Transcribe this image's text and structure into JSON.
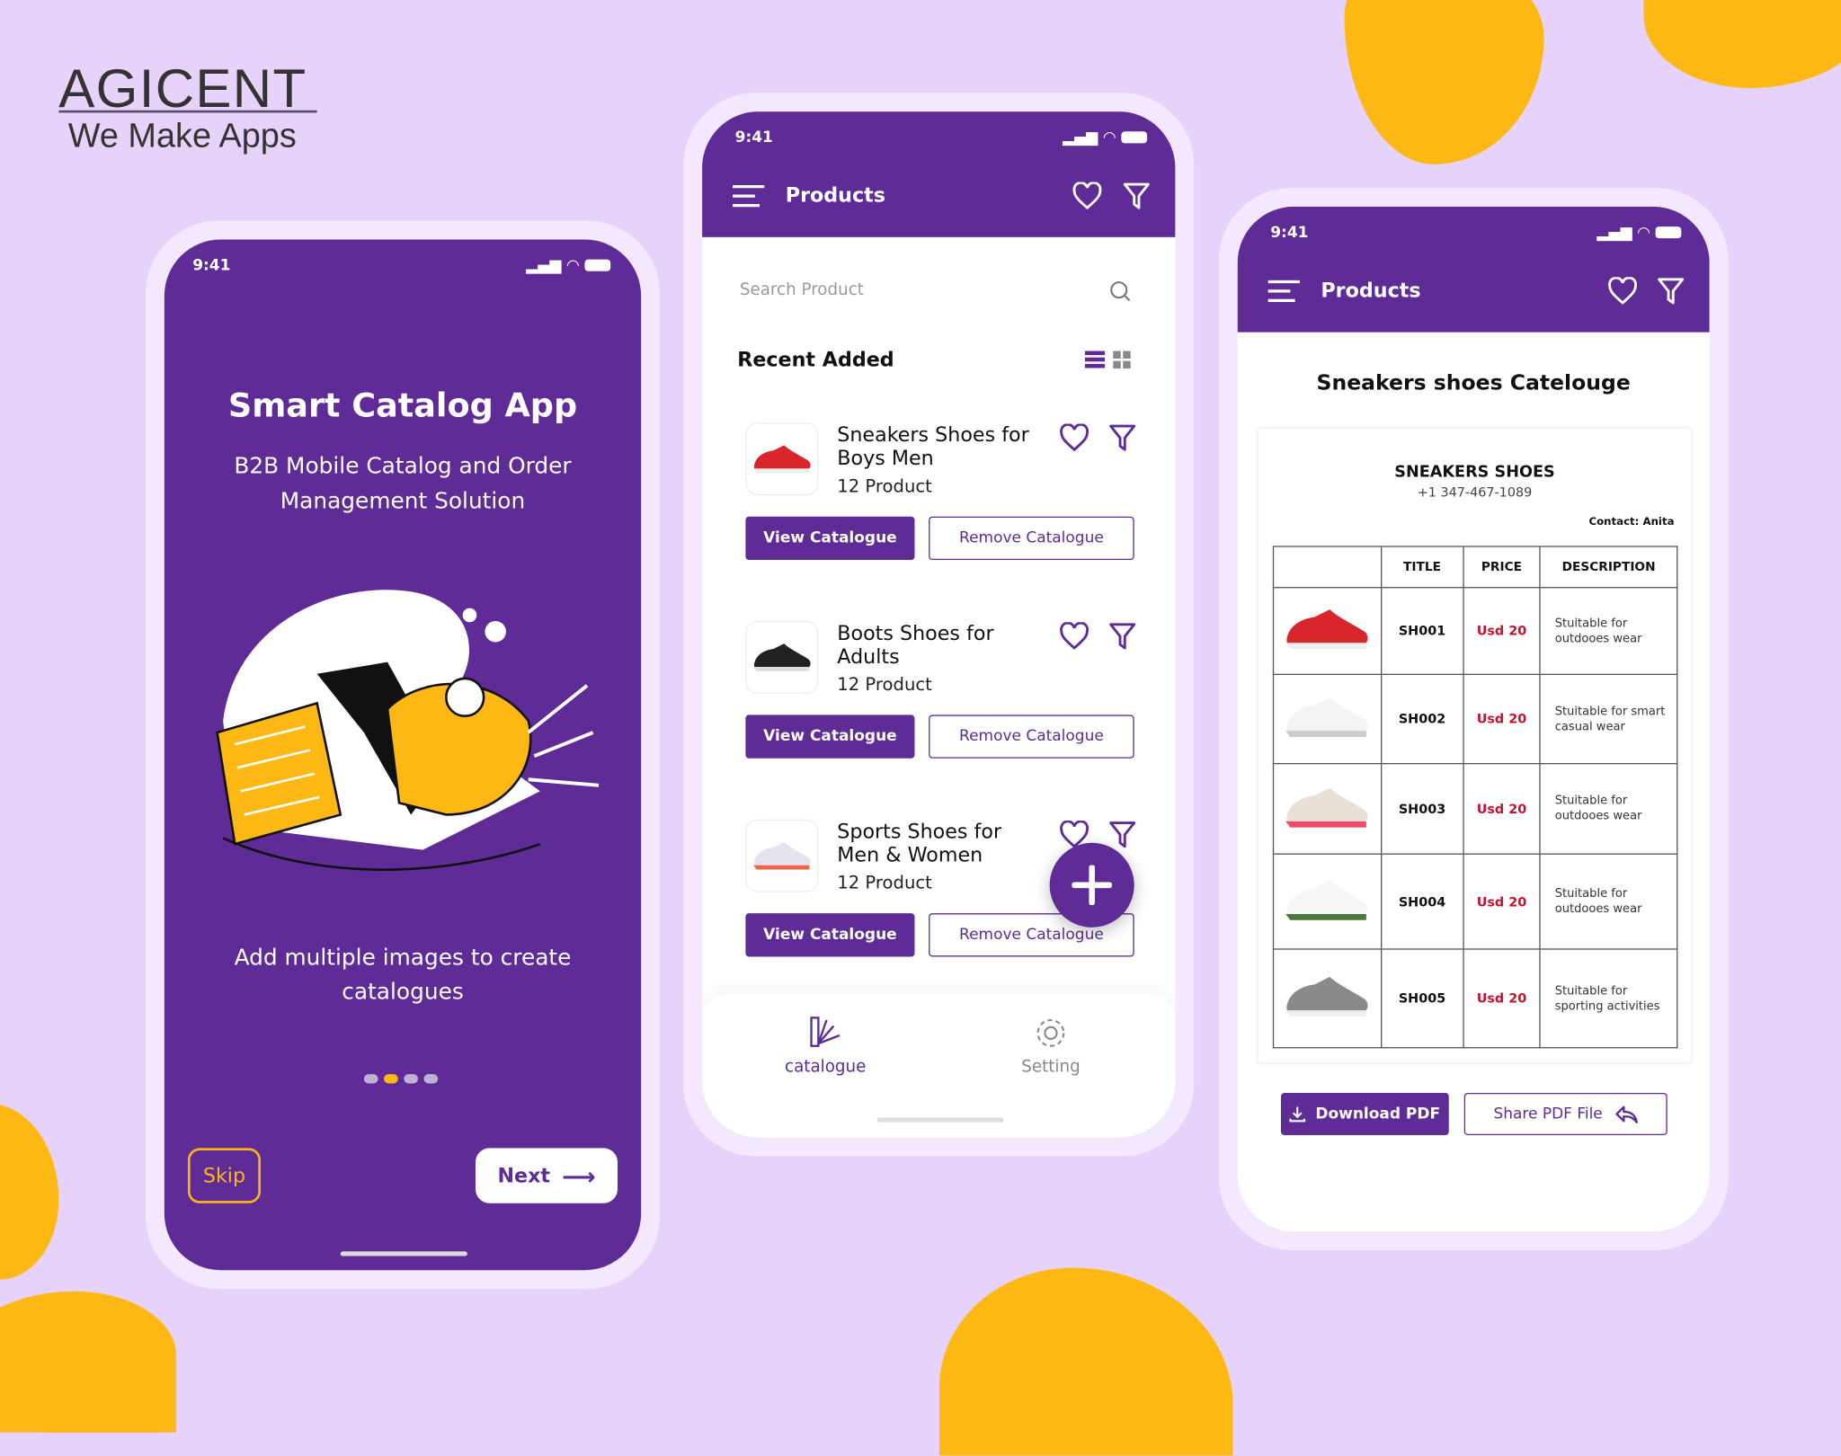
{
  "brand": {
    "logo": "AGICENT",
    "tagline": "We Make Apps"
  },
  "colors": {
    "primary": "#5e2b97",
    "background": "#e6d2fb",
    "accent": "#fdb813",
    "price": "#c8102e"
  },
  "status_time": "9:41",
  "onboarding": {
    "title": "Smart Catalog App",
    "subtitle": "B2B Mobile Catalog and Order Management Solution",
    "caption": "Add multiple images to create catalogues",
    "page_count": 4,
    "active_page": 2,
    "skip_label": "Skip",
    "next_label": "Next"
  },
  "products_screen": {
    "header_title": "Products",
    "search_placeholder": "Search Product",
    "section_title": "Recent Added",
    "view_mode": "list",
    "items": [
      {
        "title": "Sneakers Shoes for Boys Men",
        "count": "12 Product",
        "view_label": "View Catalogue",
        "remove_label": "Remove Catalogue"
      },
      {
        "title": "Boots Shoes for Adults",
        "count": "12 Product",
        "view_label": "View Catalogue",
        "remove_label": "Remove Catalogue"
      },
      {
        "title": "Sports Shoes for Men & Women",
        "count": "12 Product",
        "view_label": "View Catalogue",
        "remove_label": "Remove Catalogue"
      }
    ],
    "nav": [
      {
        "label": "catalogue",
        "icon": "swatch-icon",
        "active": true
      },
      {
        "label": "Setting",
        "icon": "gear-icon",
        "active": false
      }
    ]
  },
  "catalogue_screen": {
    "header_title": "Products",
    "title": "Sneakers shoes Catelouge",
    "doc": {
      "heading": "SNEAKERS SHOES",
      "phone": "+1 347-467-1089",
      "contact": "Contact: Anita",
      "columns": [
        "",
        "TITLE",
        "PRICE",
        "DESCRIPTION"
      ],
      "rows": [
        {
          "title": "SH001",
          "price": "Usd 20",
          "description": "Stuitable for outdooes wear"
        },
        {
          "title": "SH002",
          "price": "Usd 20",
          "description": "Stuitable for smart casual wear"
        },
        {
          "title": "SH003",
          "price": "Usd 20",
          "description": "Stuitable for outdooes wear"
        },
        {
          "title": "SH004",
          "price": "Usd 20",
          "description": "Stuitable for outdooes wear"
        },
        {
          "title": "SH005",
          "price": "Usd 20",
          "description": "Stuitable for sporting activities"
        }
      ]
    },
    "download_label": "Download PDF",
    "share_label": "Share PDF File"
  }
}
